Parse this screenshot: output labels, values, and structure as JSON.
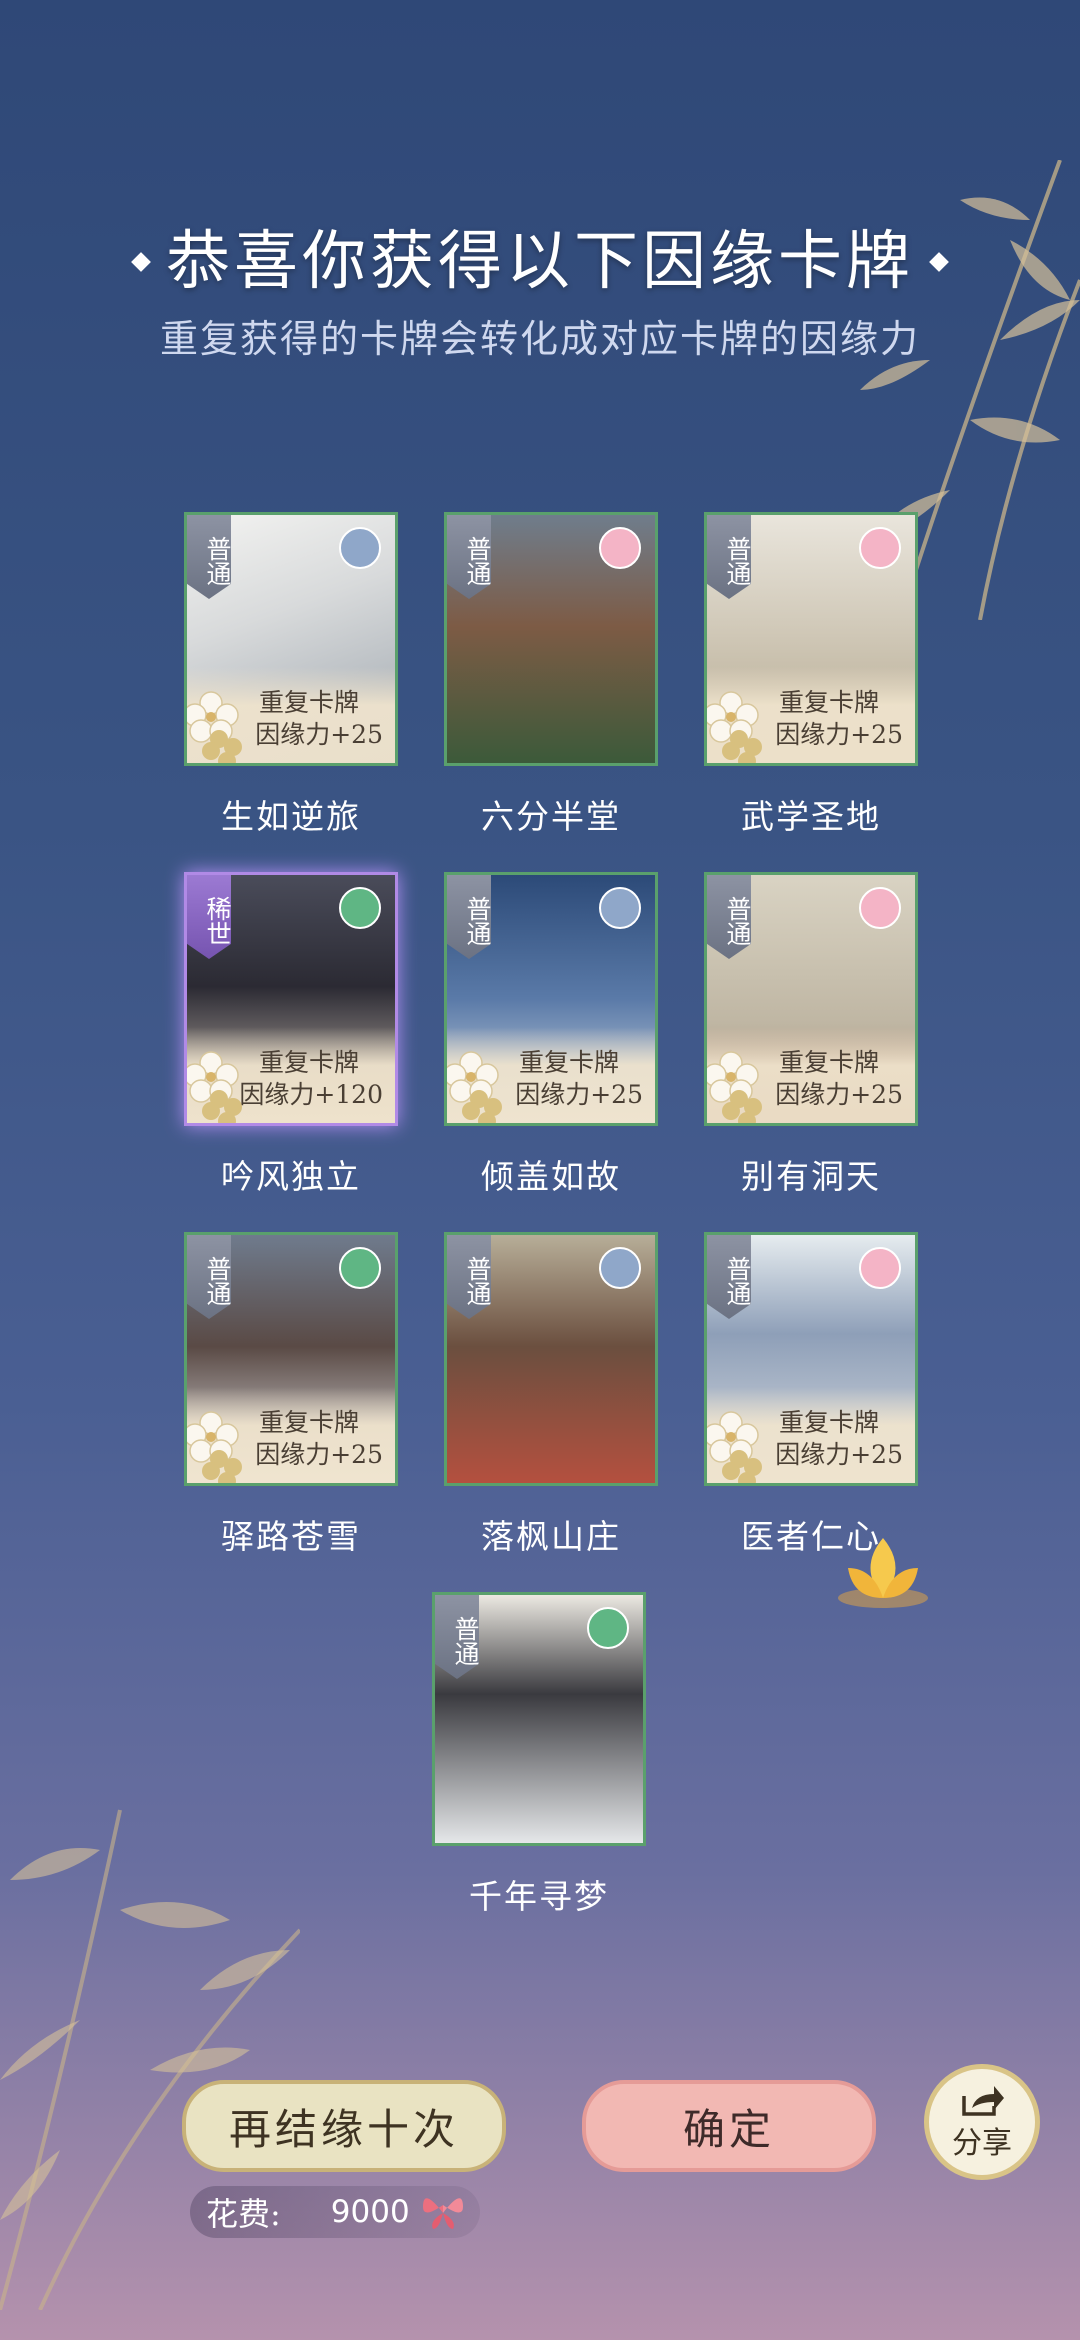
{
  "header": {
    "title": "恭喜你获得以下因缘卡牌",
    "subtitle": "重复获得的卡牌会转化成对应卡牌的因缘力"
  },
  "cards": [
    {
      "name": "生如逆旅",
      "rarity": "普通",
      "duplicate": true,
      "dup_label": "重复卡牌",
      "affinity": "因缘力+25",
      "badge": "fan"
    },
    {
      "name": "六分半堂",
      "rarity": "普通",
      "duplicate": false,
      "dup_label": "",
      "affinity": "",
      "badge": "pink-flower"
    },
    {
      "name": "武学圣地",
      "rarity": "普通",
      "duplicate": true,
      "dup_label": "重复卡牌",
      "affinity": "因缘力+25",
      "badge": "pink-flower"
    },
    {
      "name": "吟风独立",
      "rarity": "稀世",
      "duplicate": true,
      "dup_label": "重复卡牌",
      "affinity": "因缘力+120",
      "badge": "green-leaf"
    },
    {
      "name": "倾盖如故",
      "rarity": "普通",
      "duplicate": true,
      "dup_label": "重复卡牌",
      "affinity": "因缘力+25",
      "badge": "fan"
    },
    {
      "name": "别有洞天",
      "rarity": "普通",
      "duplicate": true,
      "dup_label": "重复卡牌",
      "affinity": "因缘力+25",
      "badge": "pink-flower"
    },
    {
      "name": "驿路苍雪",
      "rarity": "普通",
      "duplicate": true,
      "dup_label": "重复卡牌",
      "affinity": "因缘力+25",
      "badge": "green-leaf"
    },
    {
      "name": "落枫山庄",
      "rarity": "普通",
      "duplicate": false,
      "dup_label": "",
      "affinity": "",
      "badge": "fan"
    },
    {
      "name": "医者仁心",
      "rarity": "普通",
      "duplicate": true,
      "dup_label": "重复卡牌",
      "affinity": "因缘力+25",
      "badge": "pink-flower"
    },
    {
      "name": "千年寻梦",
      "rarity": "普通",
      "duplicate": false,
      "dup_label": "",
      "affinity": "",
      "badge": "green-leaf"
    }
  ],
  "actions": {
    "again_label": "再结缘十次",
    "confirm_label": "确定",
    "share_label": "分享",
    "cost_label": "花费:",
    "cost_value": "9000",
    "cost_icon": "butterfly-icon"
  },
  "colors": {
    "common_border": "#5aa06c",
    "rare_border": "#b18ae6",
    "confirm_button": "#f2b8b3",
    "again_button": "#e9e3c2"
  }
}
